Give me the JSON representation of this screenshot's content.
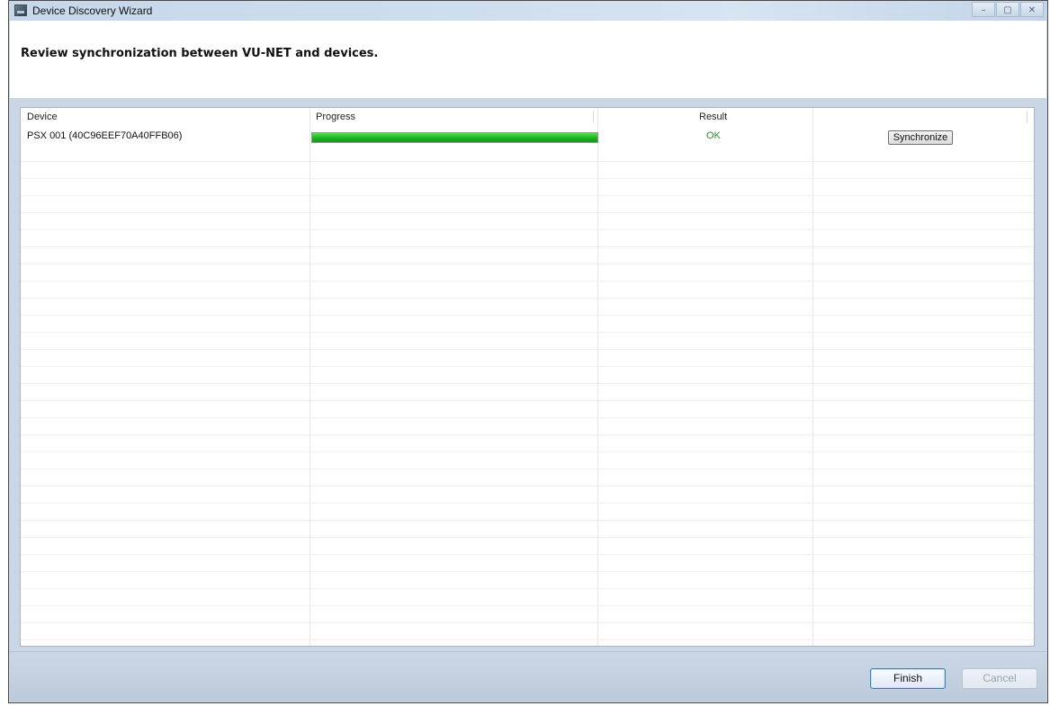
{
  "window": {
    "title": "Device Discovery Wizard",
    "icon": "wizard-app-icon",
    "controls": {
      "minimize": "–",
      "maximize": "▢",
      "close": "✕"
    }
  },
  "header": {
    "instruction": "Review synchronization between VU-NET and devices."
  },
  "table": {
    "columns": [
      "Device",
      "Progress",
      "Result"
    ],
    "rows": [
      {
        "device": "PSX 001  (40C96EEF70A40FFB06)",
        "progress_percent": 100,
        "result": "OK",
        "action_label": "Synchronize"
      }
    ]
  },
  "footer": {
    "finish_label": "Finish",
    "cancel_label": "Cancel"
  },
  "colors": {
    "progress_fill": "#1cb520",
    "result_ok": "#2e8b2e"
  }
}
